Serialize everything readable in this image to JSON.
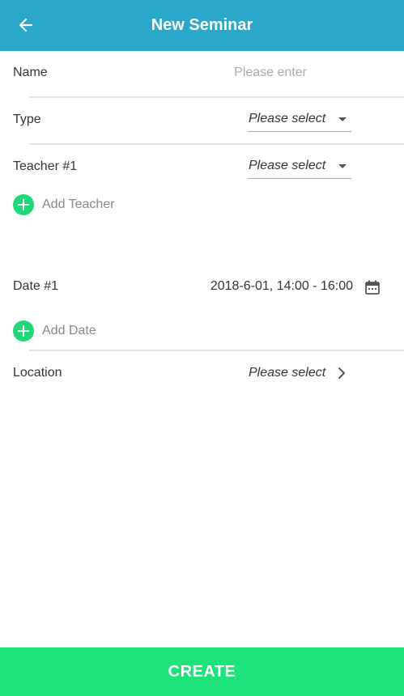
{
  "header": {
    "title": "New Seminar",
    "back_icon": "arrow-left-icon",
    "background": "#2aa8c9"
  },
  "form": {
    "name": {
      "label": "Name",
      "value": "",
      "placeholder": "Please enter"
    },
    "type": {
      "label": "Type",
      "selected": "Please select"
    },
    "teachers": [
      {
        "label": "Teacher #1",
        "selected": "Please select"
      }
    ],
    "add_teacher_label": "Add Teacher",
    "dates": [
      {
        "label": "Date #1",
        "value": "2018-6-01, 14:00 - 16:00",
        "icon": "calendar-icon"
      }
    ],
    "add_date_label": "Add Date",
    "location": {
      "label": "Location",
      "selected": "Please select",
      "icon": "chevron-right-icon"
    }
  },
  "footer": {
    "create_label": "CREATE",
    "color": "#1ee27a"
  }
}
